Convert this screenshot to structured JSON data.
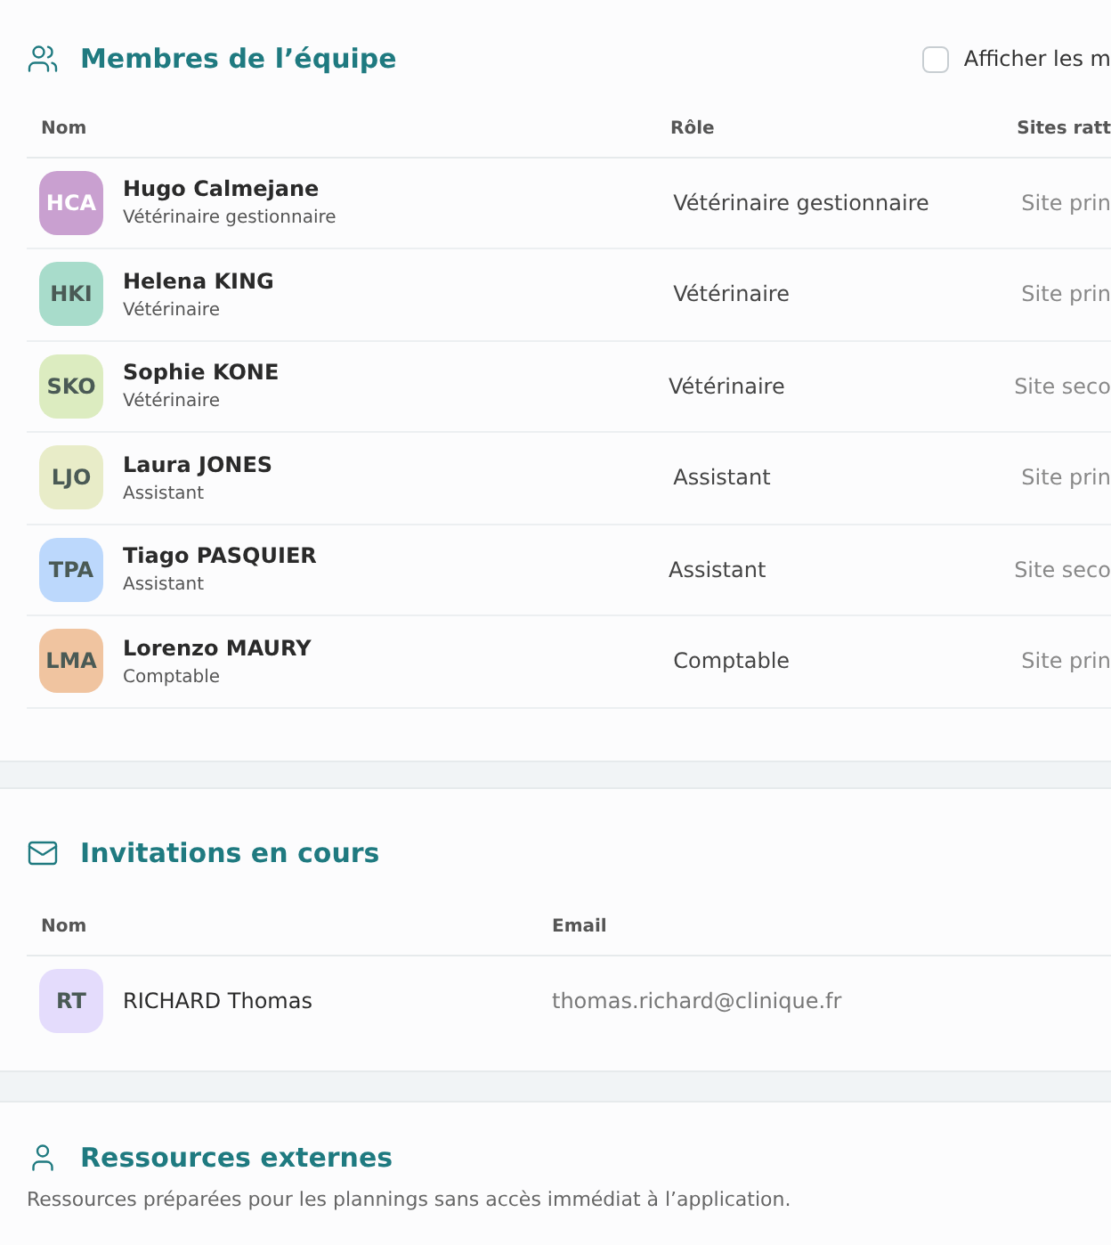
{
  "team": {
    "title": "Membres de l’équipe",
    "show_toggle": {
      "label": "Afficher les m",
      "checked": false
    },
    "columns": [
      "Nom",
      "Rôle",
      "Sites ratt"
    ],
    "rows": [
      {
        "initials": "HCA",
        "color": "#c9a0d0",
        "name": "Hugo Calmejane",
        "subtitle": "Vétérinaire gestionnaire",
        "role": "Vétérinaire gestionnaire",
        "sites": "Site prin"
      },
      {
        "initials": "HKI",
        "color": "#a8dccb",
        "name": "Helena KING",
        "subtitle": "Vétérinaire",
        "role": "Vétérinaire",
        "sites": "Site prin"
      },
      {
        "initials": "SKO",
        "color": "#dcecc0",
        "name": "Sophie KONE",
        "subtitle": "Vétérinaire",
        "role": "Vétérinaire",
        "sites": "Site seco"
      },
      {
        "initials": "LJO",
        "color": "#e8ecc8",
        "name": "Laura JONES",
        "subtitle": "Assistant",
        "role": "Assistant",
        "sites": "Site prin"
      },
      {
        "initials": "TPA",
        "color": "#bcd8fc",
        "name": "Tiago PASQUIER",
        "subtitle": "Assistant",
        "role": "Assistant",
        "sites": "Site seco"
      },
      {
        "initials": "LMA",
        "color": "#f0c4a0",
        "name": "Lorenzo MAURY",
        "subtitle": "Comptable",
        "role": "Comptable",
        "sites": "Site prin"
      }
    ]
  },
  "invitations": {
    "title": "Invitations en cours",
    "columns": [
      "Nom",
      "Email"
    ],
    "rows": [
      {
        "initials": "RT",
        "color": "#e4dcfc",
        "name": "RICHARD Thomas",
        "email": "thomas.richard@clinique.fr"
      }
    ]
  },
  "external": {
    "title": "Ressources externes",
    "description": "Ressources préparées pour les plannings sans accès immédiat à l’application."
  }
}
